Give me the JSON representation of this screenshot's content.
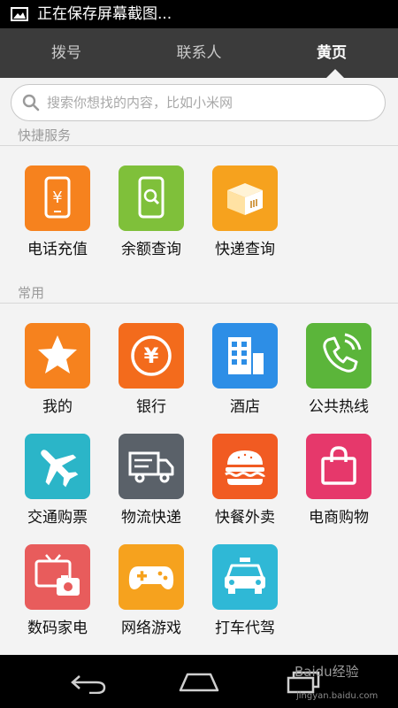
{
  "status_bar": {
    "text": "正在保存屏幕截图..."
  },
  "tabs": [
    {
      "label": "拨号"
    },
    {
      "label": "联系人"
    },
    {
      "label": "黄页",
      "active": true
    }
  ],
  "search": {
    "placeholder": "搜索你想找的内容，比如小米网"
  },
  "sections": {
    "quick": {
      "title": "快捷服务"
    },
    "common": {
      "title": "常用"
    }
  },
  "quick_items": [
    {
      "label": "电话充值",
      "icon": "phone-recharge-icon",
      "color": "#f6821e"
    },
    {
      "label": "余额查询",
      "icon": "balance-search-icon",
      "color": "#7fc03a"
    },
    {
      "label": "快递查询",
      "icon": "express-box-icon",
      "color": "#f6a21e"
    }
  ],
  "common_items": [
    {
      "label": "我的",
      "icon": "star-icon",
      "color": "#f6821e"
    },
    {
      "label": "银行",
      "icon": "yen-coin-icon",
      "color": "#f36b1c"
    },
    {
      "label": "酒店",
      "icon": "hotel-building-icon",
      "color": "#2d8ee6"
    },
    {
      "label": "公共热线",
      "icon": "phone-call-icon",
      "color": "#5bb53a"
    },
    {
      "label": "交通购票",
      "icon": "airplane-icon",
      "color": "#2bb5c8"
    },
    {
      "label": "物流快递",
      "icon": "truck-icon",
      "color": "#5a6169"
    },
    {
      "label": "快餐外卖",
      "icon": "burger-icon",
      "color": "#f15b22"
    },
    {
      "label": "电商购物",
      "icon": "shopping-bag-icon",
      "color": "#e6386b"
    },
    {
      "label": "数码家电",
      "icon": "tv-camera-icon",
      "color": "#e85c5c"
    },
    {
      "label": "网络游戏",
      "icon": "gamepad-icon",
      "color": "#f6a21e"
    },
    {
      "label": "打车代驾",
      "icon": "taxi-icon",
      "color": "#2fb8d6"
    }
  ],
  "watermark": {
    "brand": "Baidu经验",
    "url": "jingyan.baidu.com"
  }
}
